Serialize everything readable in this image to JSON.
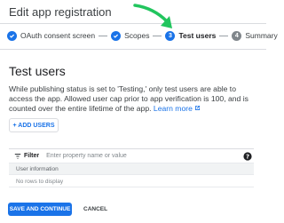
{
  "header": {
    "title": "Edit app registration"
  },
  "stepper": {
    "steps": [
      {
        "label": "OAuth consent screen",
        "state": "done",
        "icon": "check-icon"
      },
      {
        "label": "Scopes",
        "state": "done",
        "icon": "check-icon"
      },
      {
        "label": "Test users",
        "state": "current",
        "number": "3"
      },
      {
        "label": "Summary",
        "state": "todo",
        "number": "4"
      }
    ]
  },
  "main": {
    "title": "Test users",
    "description": "While publishing status is set to 'Testing,' only test users are able to access the app. Allowed user cap prior to app verification is 100, and is counted over the entire lifetime of the app.",
    "learn_more": "Learn more",
    "add_users": "+ ADD USERS"
  },
  "table": {
    "filter_label": "Filter",
    "filter_placeholder": "Enter property name or value",
    "column_header": "User information",
    "empty_text": "No rows to display"
  },
  "actions": {
    "save": "SAVE AND CONTINUE",
    "cancel": "CANCEL"
  },
  "colors": {
    "accent": "#1a73e8",
    "arrow": "#22c55e"
  }
}
